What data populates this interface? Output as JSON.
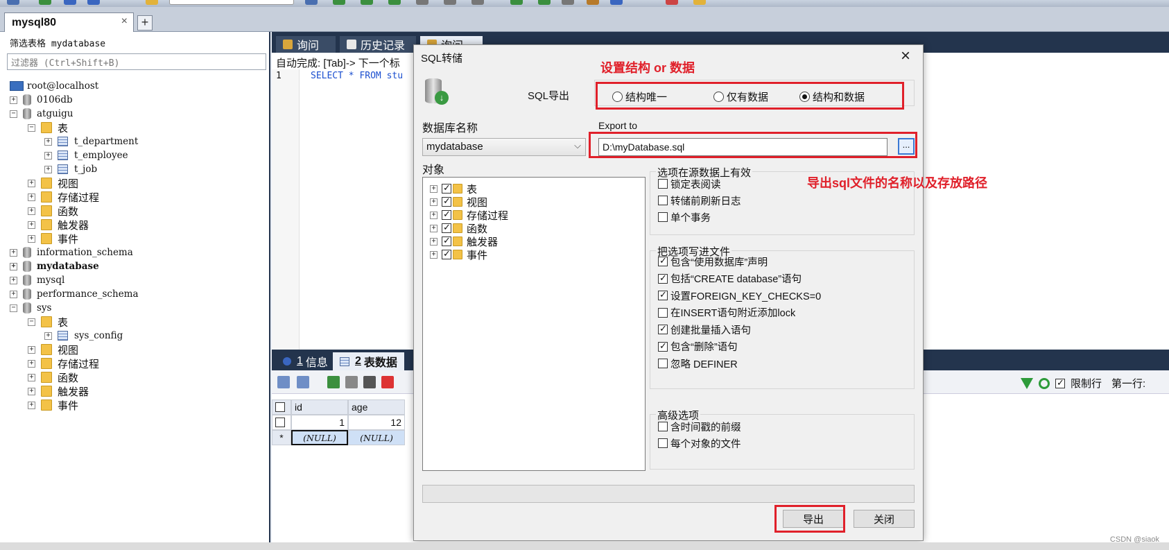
{
  "connection_tab": {
    "label": "mysql80",
    "close": "×",
    "add": "+"
  },
  "sidebar": {
    "filter_label": "筛选表格 mydatabase",
    "filter_placeholder": "过滤器 (Ctrl+Shift+B)",
    "tree": [
      {
        "label": "root@localhost",
        "icon": "host-icon",
        "depth": 0,
        "expander": ""
      },
      {
        "label": "0106db",
        "icon": "database-icon",
        "depth": 0,
        "expander": "+"
      },
      {
        "label": "atguigu",
        "icon": "database-icon",
        "depth": 0,
        "expander": "−"
      },
      {
        "label": "表",
        "icon": "folder-icon",
        "depth": 1,
        "expander": "−"
      },
      {
        "label": "t_department",
        "icon": "table-icon",
        "depth": 2,
        "expander": "+"
      },
      {
        "label": "t_employee",
        "icon": "table-icon",
        "depth": 2,
        "expander": "+"
      },
      {
        "label": "t_job",
        "icon": "table-icon",
        "depth": 2,
        "expander": "+"
      },
      {
        "label": "视图",
        "icon": "folder-icon",
        "depth": 1,
        "expander": "+"
      },
      {
        "label": "存储过程",
        "icon": "folder-icon",
        "depth": 1,
        "expander": "+"
      },
      {
        "label": "函数",
        "icon": "folder-icon",
        "depth": 1,
        "expander": "+"
      },
      {
        "label": "触发器",
        "icon": "folder-icon",
        "depth": 1,
        "expander": "+"
      },
      {
        "label": "事件",
        "icon": "folder-icon",
        "depth": 1,
        "expander": "+"
      },
      {
        "label": "information_schema",
        "icon": "database-icon",
        "depth": 0,
        "expander": "+"
      },
      {
        "label": "mydatabase",
        "icon": "database-icon",
        "depth": 0,
        "expander": "+",
        "bold": true
      },
      {
        "label": "mysql",
        "icon": "database-icon",
        "depth": 0,
        "expander": "+"
      },
      {
        "label": "performance_schema",
        "icon": "database-icon",
        "depth": 0,
        "expander": "+"
      },
      {
        "label": "sys",
        "icon": "database-icon",
        "depth": 0,
        "expander": "−"
      },
      {
        "label": "表",
        "icon": "folder-icon",
        "depth": 1,
        "expander": "−"
      },
      {
        "label": "sys_config",
        "icon": "table-icon",
        "depth": 2,
        "expander": "+"
      },
      {
        "label": "视图",
        "icon": "folder-icon",
        "depth": 1,
        "expander": "+"
      },
      {
        "label": "存储过程",
        "icon": "folder-icon",
        "depth": 1,
        "expander": "+"
      },
      {
        "label": "函数",
        "icon": "folder-icon",
        "depth": 1,
        "expander": "+"
      },
      {
        "label": "触发器",
        "icon": "folder-icon",
        "depth": 1,
        "expander": "+"
      },
      {
        "label": "事件",
        "icon": "folder-icon",
        "depth": 1,
        "expander": "+"
      }
    ]
  },
  "query_tabs": [
    {
      "label": "询问",
      "icon": "query-icon"
    },
    {
      "label": "历史记录",
      "icon": "history-icon"
    },
    {
      "label": "询问",
      "icon": "query-icon",
      "active": true
    }
  ],
  "editor": {
    "autocomplete": "自动完成: [Tab]-> 下一个标",
    "line_number": "1",
    "sql": "SELECT * FROM stu"
  },
  "result_tabs": [
    {
      "num": "1",
      "label": "信息",
      "active": false
    },
    {
      "num": "2",
      "label": "表数据",
      "active": true
    }
  ],
  "result_toolbar": {
    "limit_label": "限制行",
    "first_row_label": "第一行:"
  },
  "grid": {
    "columns": [
      "id",
      "age"
    ],
    "rows": [
      {
        "marker": "",
        "id": "1",
        "age": "12"
      },
      {
        "marker": "*",
        "id": "(NULL)",
        "age": "(NULL)"
      }
    ]
  },
  "dialog": {
    "title": "SQL转储",
    "close": "×",
    "sql_export_label": "SQL导出",
    "export_modes": [
      {
        "label": "结构唯一",
        "selected": false
      },
      {
        "label": "仅有数据",
        "selected": false
      },
      {
        "label": "结构和数据",
        "selected": true
      }
    ],
    "db_name_label": "数据库名称",
    "db_name_value": "mydatabase",
    "export_to_label": "Export to",
    "export_path": "D:\\myDatabase.sql",
    "browse_label": "...",
    "objects_label": "对象",
    "objects": [
      {
        "label": "表",
        "checked": true
      },
      {
        "label": "视图",
        "checked": true
      },
      {
        "label": "存储过程",
        "checked": true
      },
      {
        "label": "函数",
        "checked": true
      },
      {
        "label": "触发器",
        "checked": true
      },
      {
        "label": "事件",
        "checked": true
      }
    ],
    "source_options_title": "选项在源数据上有效",
    "source_options": [
      {
        "label": "锁定表阅读",
        "checked": false
      },
      {
        "label": "转储前刷新日志",
        "checked": false
      },
      {
        "label": "单个事务",
        "checked": false
      }
    ],
    "file_options_title": "把选项写进文件",
    "file_options": [
      {
        "label": "包含“使用数据库”声明",
        "checked": true
      },
      {
        "label": "包括“CREATE database”语句",
        "checked": true
      },
      {
        "label": "设置FOREIGN_KEY_CHECKS=0",
        "checked": true
      },
      {
        "label": "在INSERT语句附近添加lock",
        "checked": false
      },
      {
        "label": "创建批量插入语句",
        "checked": true
      },
      {
        "label": "包含“删除”语句",
        "checked": true
      },
      {
        "label": "忽略 DEFINER",
        "checked": false
      }
    ],
    "advanced_title": "高级选项",
    "advanced_options": [
      {
        "label": "含时间戳的前缀",
        "checked": false
      },
      {
        "label": "每个对象的文件",
        "checked": false
      }
    ],
    "export_button": "导出",
    "close_button": "关闭"
  },
  "annotations": {
    "structure_or_data": "设置结构 or 数据",
    "file_name_and_path": "导出sql文件的名称以及存放路径",
    "annotation_color": "#e0202a"
  },
  "watermark": "CSDN @siaok"
}
